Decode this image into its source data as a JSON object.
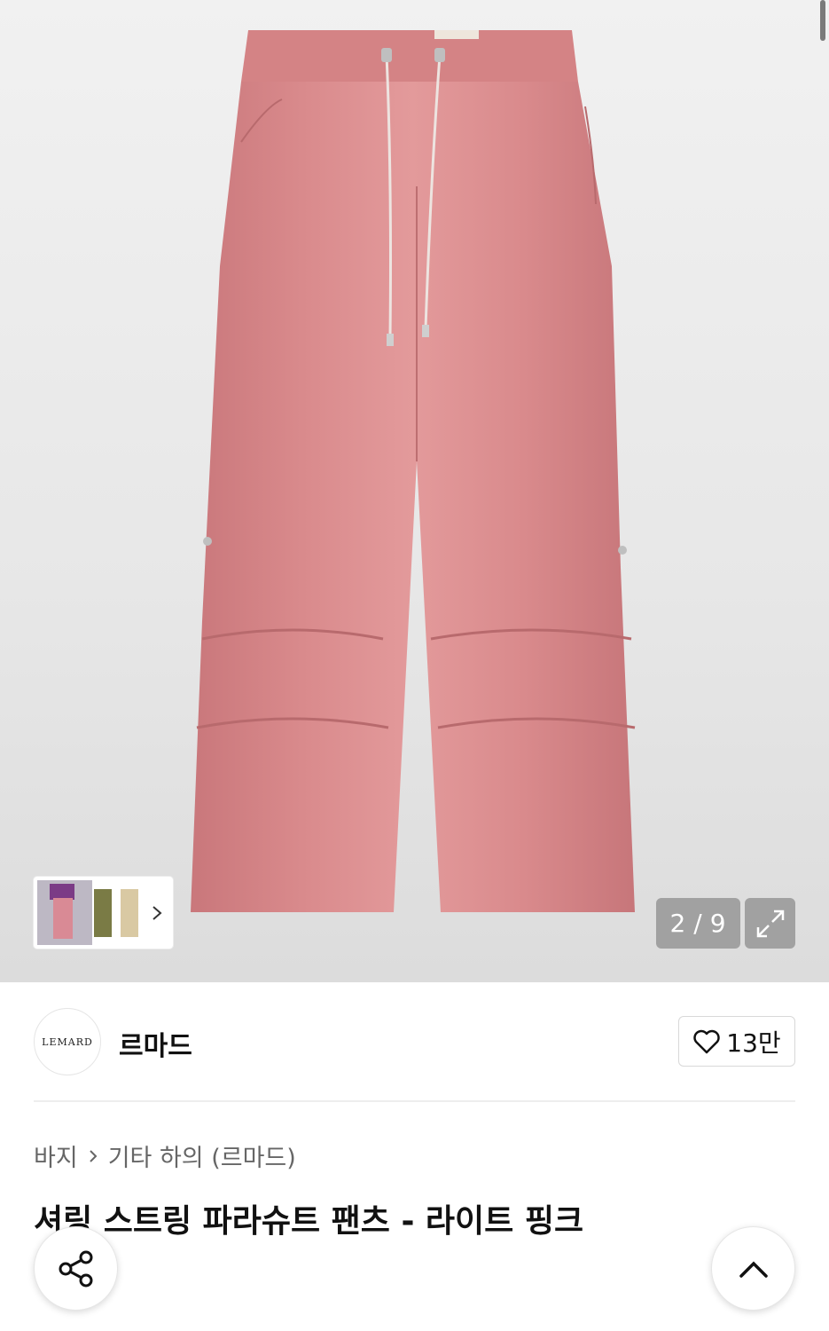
{
  "gallery": {
    "current": "2",
    "total": "9",
    "counter_sep": "/",
    "product_color": "#d98a8c",
    "icons": {
      "expand": "expand-icon",
      "next": "chevron-right-icon"
    }
  },
  "brand": {
    "logo_text": "LEMARD",
    "name": "르마드",
    "likes": "13만",
    "like_icon": "heart-outline-icon"
  },
  "breadcrumb": {
    "items": [
      "바지",
      "기타 하의 (르마드)"
    ]
  },
  "product": {
    "title": "셔링 스트링 파라슈트 팬츠 - 라이트 핑크"
  },
  "actions": {
    "share_icon": "share-icon",
    "top_icon": "chevron-up-icon"
  }
}
